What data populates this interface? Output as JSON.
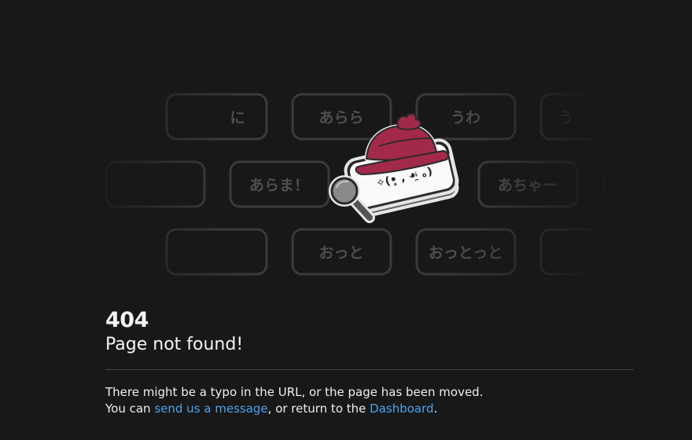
{
  "illustration": {
    "keys": [
      "あらら",
      "うわ",
      "あらま！",
      "あちゃー",
      "おっと",
      "おっとっと"
    ],
    "mascot_face": "✧(•̥ , ☙̯ ｡)",
    "hat_color": "#a3294a"
  },
  "error": {
    "code": "404",
    "title": "Page not found!"
  },
  "message": {
    "line1": "There might be a typo in the URL, or the page has been moved.",
    "line2_prefix": "You can ",
    "send_link": "send us a message",
    "line2_middle": ", or return to the ",
    "dashboard_link": "Dashboard",
    "line2_suffix": "."
  },
  "colors": {
    "background": "#181818",
    "link": "#4aa3ee",
    "key_border": "#3a3a3a",
    "key_text": "#4e4e4e"
  }
}
